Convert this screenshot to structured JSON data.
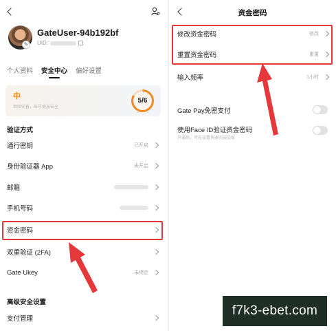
{
  "left": {
    "profile": {
      "username": "GateUser-94b192bf",
      "uid_label": "UID:"
    },
    "tabs": [
      {
        "label": "个人资料",
        "active": false
      },
      {
        "label": "安全中心",
        "active": true
      },
      {
        "label": "偏好设置",
        "active": false
      }
    ],
    "security_level": {
      "label": "中",
      "description": "继续完善，账号更加安全",
      "progress": "5/6",
      "progress_fraction": 0.833,
      "color": "#f08a24"
    },
    "verification_section_title": "验证方式",
    "verification_items": [
      {
        "label": "通行密钥",
        "value": "已开启"
      },
      {
        "label": "身份验证器 App",
        "value": "未开启"
      },
      {
        "label": "邮箱",
        "value": ""
      },
      {
        "label": "手机号码",
        "value": ""
      },
      {
        "label": "资金密码",
        "value": ""
      },
      {
        "label": "双重验证 (2FA)",
        "value": ""
      },
      {
        "label": "Gate Ukey",
        "value": "未绑定"
      }
    ],
    "advanced_section_title": "高级安全设置",
    "advanced_items": [
      {
        "label": "支付管理",
        "value": ""
      }
    ]
  },
  "right": {
    "title": "资金密码",
    "items": [
      {
        "label": "修改资金密码",
        "value": "修改"
      },
      {
        "label": "重置资金密码",
        "value": "重置"
      }
    ],
    "input_frequency": {
      "label": "输入频率",
      "value": "1小时"
    },
    "toggles": [
      {
        "label": "Gate Pay免密支付",
        "enabled": false
      },
      {
        "label": "使用Face ID验证资金密码",
        "sub": "开通后，可在设置快速完成交易",
        "enabled": false
      }
    ]
  },
  "annotation_color": "#e4383b",
  "watermark": "f7k3-ebet.com"
}
